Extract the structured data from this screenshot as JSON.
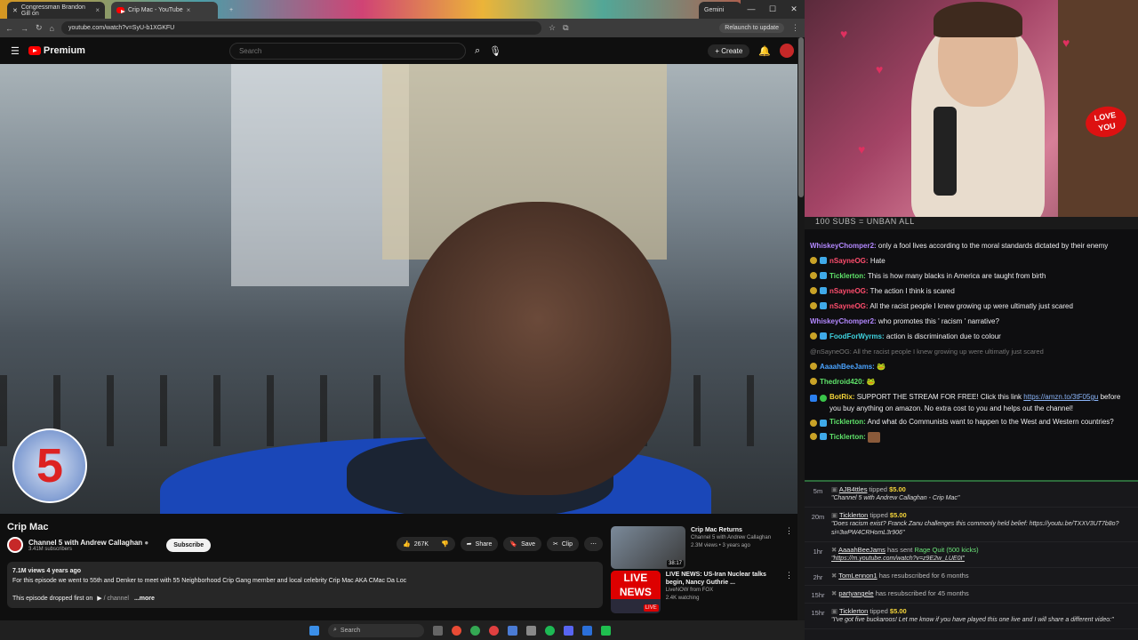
{
  "browser": {
    "tabs": [
      {
        "label": "Congressman Brandon Gill on"
      },
      {
        "label": "Crip Mac - YouTube"
      },
      {
        "label": "Gemini"
      }
    ],
    "url": "youtube.com/watch?v=SyU-b1XGKFU",
    "relaunch_label": "Relaunch to update"
  },
  "youtube": {
    "logo_label": "Premium",
    "search_placeholder": "Search",
    "create_label": "Create",
    "video_title": "Crip Mac",
    "channel_name": "Channel 5 with Andrew Callaghan",
    "subscribers": "3.41M subscribers",
    "subscribe_label": "Subscribe",
    "likes": "267K",
    "share_label": "Share",
    "save_label": "Save",
    "clip_label": "Clip",
    "views_meta": "7.1M views  4 years ago",
    "description": "For this episode we went to 55th and Denker to meet with 55 Neighborhood Crip Gang member and local celebrity Crip Mac AKA CMac Da Loc",
    "desc_line2": "This episode dropped first on",
    "desc_channel": "/ channel",
    "more_label": "...more",
    "channel_logo_text": "5",
    "recommendations": [
      {
        "title": "Crip Mac Returns",
        "channel": "Channel 5 with Andrew Callaghan",
        "meta": "2.3M views • 3 years ago",
        "duration": "38:17"
      },
      {
        "title": "LIVE NEWS: US-Iran Nuclear talks begin, Nancy Guthrie ...",
        "channel": "LiveNOW from FOX",
        "meta": "2.4K watching",
        "badge": "LIVE NEWS",
        "live": "LIVE"
      }
    ]
  },
  "taskbar": {
    "search_label": "Search"
  },
  "stream": {
    "banner": "100 SUBS = UNBAN ALL",
    "love_sign": "LOVE YOU",
    "chat": [
      {
        "user": "WhiskeyChomper2:",
        "color": "#b388ff",
        "text": "only a fool lives according to the moral standards dictated by their enemy",
        "badges": false
      },
      {
        "user": "nSayneOG:",
        "color": "#ff4d6d",
        "text": "Hate",
        "badges": true
      },
      {
        "user": "Ticklerton:",
        "color": "#5fe36a",
        "text": "This is how many blacks in America are taught from birth",
        "badges": true
      },
      {
        "user": "nSayneOG:",
        "color": "#ff4d6d",
        "text": "The action I think is scared",
        "badges": true
      },
      {
        "user": "nSayneOG:",
        "color": "#ff4d6d",
        "text": "All the racist people I knew growing up were ultimatly just scared",
        "badges": true
      },
      {
        "user": "WhiskeyChomper2:",
        "color": "#b388ff",
        "text": "who promotes this ' racism ' narrative?",
        "badges": false
      },
      {
        "user": "FoodForWyrms:",
        "color": "#3fd3e0",
        "text": "action is discrimination due to colour",
        "badges": true
      }
    ],
    "reply": "@nSayneOG: All the racist people I knew growing up were ultimatly just scared",
    "chat2": [
      {
        "user": "AaaahBeeJams:",
        "color": "#4aa3ff",
        "text": ""
      },
      {
        "user": "Thedroid420:",
        "color": "#5fe36a",
        "text": ""
      }
    ],
    "botrix": {
      "user": "BotRix:",
      "text": "SUPPORT THE STREAM FOR FREE! Click this link",
      "link": "https://amzn.to/3tF05gu",
      "text2": "before you buy anything on amazon. No extra cost to you and helps out the channel!"
    },
    "ticklerton_long": {
      "user": "Ticklerton:",
      "text": "And what do Communists want to happen to the West and Western countries?"
    },
    "ticklerton_last": {
      "user": "Ticklerton:"
    },
    "events": [
      {
        "time": "5m",
        "name": "AJB4ttles",
        "action": "tipped",
        "amount": "$5.00",
        "quote": "\"Channel 5 with Andrew Callaghan - Crip Mac\""
      },
      {
        "time": "20m",
        "name": "Ticklerton",
        "action": "tipped",
        "amount": "$5.00",
        "quote": "\"Does racism exist? Franck Zanu challenges this commonly held belief: https://youtu.be/TXXV3UT7b8o?si=3wPW4CRHomL3r906\""
      },
      {
        "time": "1hr",
        "name": "AaaahBeeJams",
        "action": "has sent",
        "amount": "Rage Quit (500 kicks)",
        "quote": "\"https://m.youtube.com/watch?v=z9E2w_LUE0I\""
      },
      {
        "time": "2hr",
        "name": "TomLennon1",
        "action": "has resubscribed for 6 months",
        "amount": "",
        "quote": ""
      },
      {
        "time": "15hr",
        "name": "partyangele",
        "action": "has resubscribed for 45 months",
        "amount": "",
        "quote": ""
      },
      {
        "time": "15hr",
        "name": "Ticklerton",
        "action": "tipped",
        "amount": "$5.00",
        "quote": "\"I've got five buckaroos! Let me know if you have played this one live and I will share a different video:\""
      }
    ]
  }
}
